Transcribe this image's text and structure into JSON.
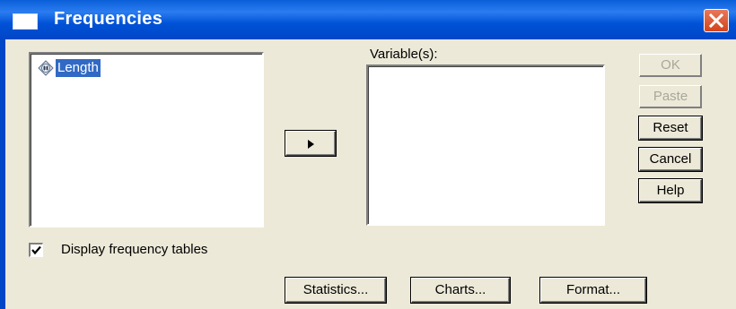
{
  "window": {
    "title": "Frequencies"
  },
  "source_list": {
    "items": [
      {
        "label": "Length",
        "icon": "numeric-scale-variable-icon",
        "selected": true
      }
    ]
  },
  "target_list": {
    "label": "Variable(s):",
    "items": []
  },
  "move_button": {
    "icon": "right-arrow-icon"
  },
  "side_buttons": {
    "ok": "OK",
    "paste": "Paste",
    "reset": "Reset",
    "cancel": "Cancel",
    "help": "Help"
  },
  "checkbox": {
    "label": "Display frequency tables",
    "checked": true
  },
  "bottom_buttons": {
    "statistics": "Statistics...",
    "charts": "Charts...",
    "format": "Format..."
  },
  "colors": {
    "titlebar": "#0052d6",
    "selection": "#316ac5",
    "dialog_bg": "#ece9d8",
    "close_button": "#d3441b"
  }
}
